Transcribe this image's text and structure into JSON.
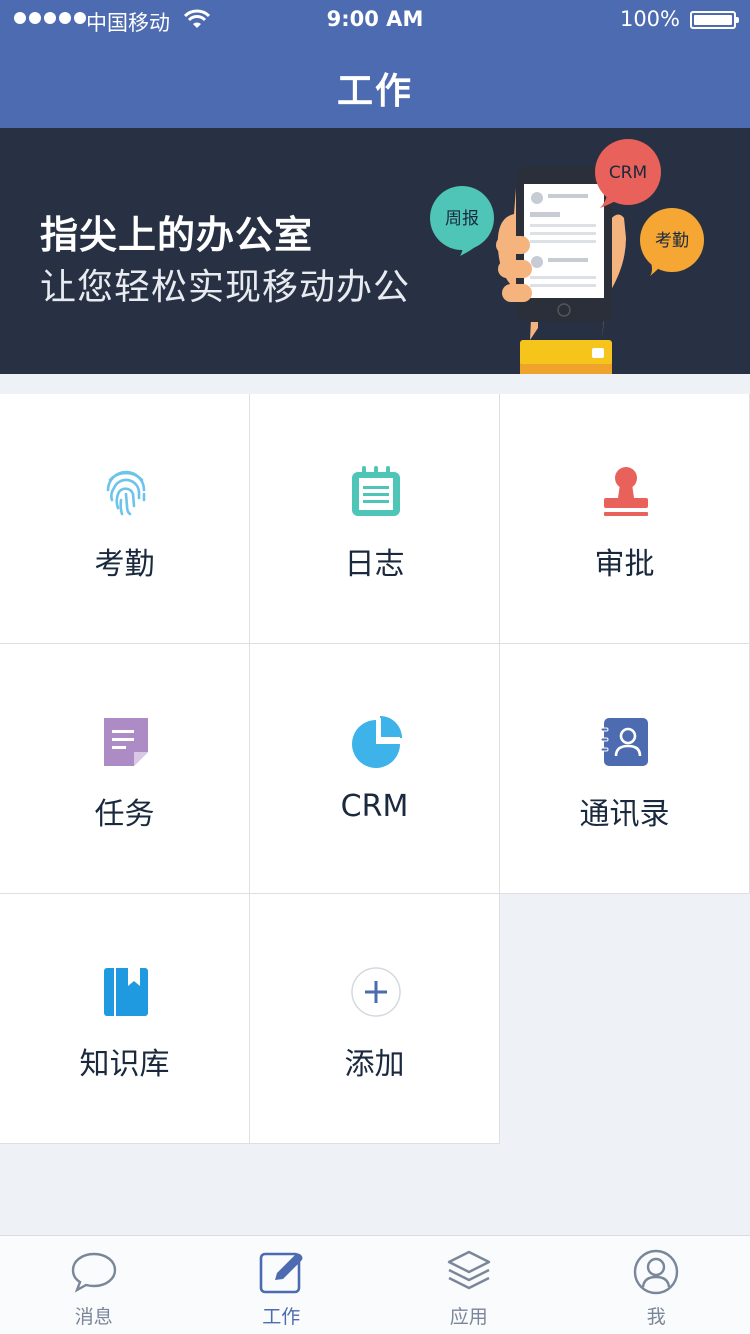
{
  "status_bar": {
    "carrier": "中国移动",
    "time": "9:00 AM",
    "battery": "100%"
  },
  "nav": {
    "title": "工作"
  },
  "banner": {
    "title": "指尖上的办公室",
    "subtitle": "让您轻松实现移动办公",
    "bubbles": {
      "report": "周报",
      "crm": "CRM",
      "attendance": "考勤"
    }
  },
  "grid": {
    "items": [
      {
        "label": "考勤",
        "icon": "fingerprint-icon",
        "color": "#6dc3ea"
      },
      {
        "label": "日志",
        "icon": "notepad-icon",
        "color": "#4ec5b7"
      },
      {
        "label": "审批",
        "icon": "stamp-icon",
        "color": "#e8615a"
      },
      {
        "label": "任务",
        "icon": "task-document-icon",
        "color": "#ad8bc4"
      },
      {
        "label": "CRM",
        "icon": "pie-chart-icon",
        "color": "#3db3ea"
      },
      {
        "label": "通讯录",
        "icon": "contacts-book-icon",
        "color": "#4d6bb0"
      },
      {
        "label": "知识库",
        "icon": "bookmark-book-icon",
        "color": "#1f9ae0"
      },
      {
        "label": "添加",
        "icon": "add-icon",
        "color": "#4d6bb0"
      }
    ]
  },
  "tabbar": {
    "items": [
      {
        "label": "消息",
        "icon": "chat-bubble-icon"
      },
      {
        "label": "工作",
        "icon": "edit-icon",
        "active": true
      },
      {
        "label": "应用",
        "icon": "layers-icon"
      },
      {
        "label": "我",
        "icon": "user-icon"
      }
    ]
  },
  "colors": {
    "primary": "#4d6bb0",
    "banner_bg": "#283143",
    "text": "#1a293e",
    "divider": "#dfdfdf",
    "page_bg": "#eef1f5"
  }
}
